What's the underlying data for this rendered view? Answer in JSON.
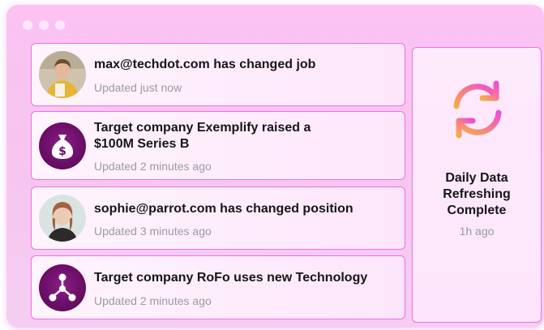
{
  "feed": {
    "items": [
      {
        "title": "max@techdot.com has changed job",
        "updated": "Updated just now",
        "avatar": "person-photo"
      },
      {
        "title": "Target company Exemplify raised a $100M Series B",
        "updated": "Updated 2 minutes ago",
        "avatar": "money-bag-icon"
      },
      {
        "title": "sophie@parrot.com has changed position",
        "updated": "Updated 3 minutes ago",
        "avatar": "person-photo"
      },
      {
        "title": "Target company RoFo uses new Technology",
        "updated": "Updated 2 minutes ago",
        "avatar": "network-nodes-icon"
      }
    ]
  },
  "status": {
    "title": "Daily Data Refreshing Complete",
    "time": "1h ago",
    "icon": "refresh-icon"
  },
  "colors": {
    "accent": "#ef6fe2",
    "icon_bg": "#6b0f68",
    "refresh_gradient": [
      "#f8a94b",
      "#ee4fd3"
    ]
  }
}
